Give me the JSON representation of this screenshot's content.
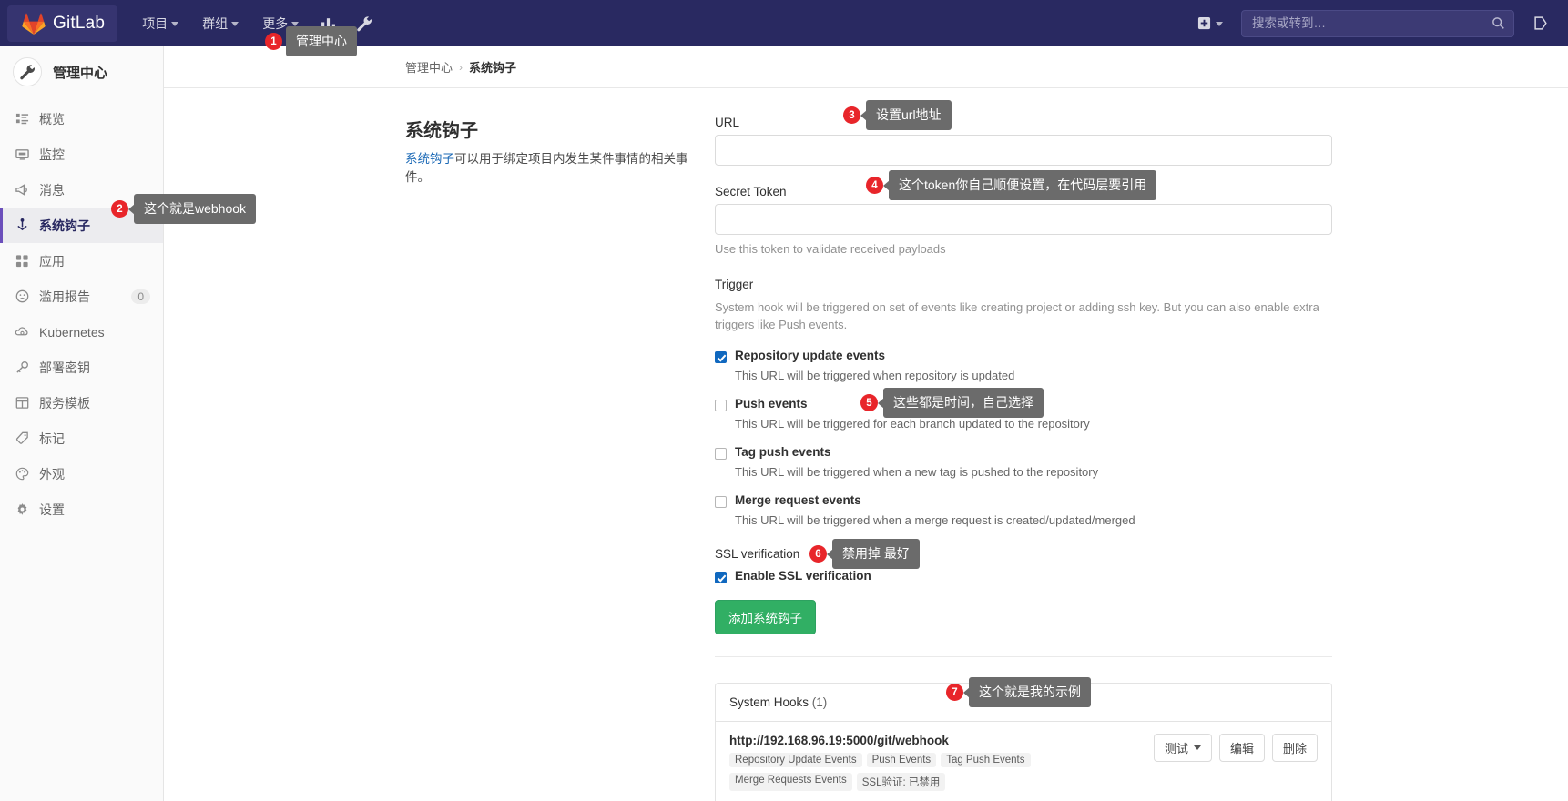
{
  "navbar": {
    "brand": "GitLab",
    "brand_icon": "gitlab-tanuki-logo",
    "items": [
      {
        "label": "项目",
        "icon": "chevron-down-icon"
      },
      {
        "label": "群组",
        "icon": "chevron-down-icon"
      },
      {
        "label": "更多",
        "icon": "chevron-down-icon"
      }
    ],
    "analytics_icon": "chart-bar-icon",
    "admin_icon": "wrench-icon",
    "plus_icon": "plus-square-icon",
    "plus_caret_icon": "chevron-down-icon",
    "search": {
      "placeholder": "搜索或转到…",
      "value": "",
      "icon": "search-icon"
    },
    "issues_icon": "issues-icon"
  },
  "sidebar": {
    "title": "管理中心",
    "avatar_icon": "wrench-icon",
    "items": [
      {
        "label": "概览",
        "icon": "overview-icon",
        "count": "",
        "active": false
      },
      {
        "label": "监控",
        "icon": "monitor-icon",
        "count": "",
        "active": false
      },
      {
        "label": "消息",
        "icon": "megaphone-icon",
        "count": "",
        "active": false
      },
      {
        "label": "系统钩子",
        "icon": "hook-icon",
        "count": "",
        "active": true
      },
      {
        "label": "应用",
        "icon": "applications-icon",
        "count": "",
        "active": false
      },
      {
        "label": "滥用报告",
        "icon": "sad-face-icon",
        "count": "0",
        "active": false
      },
      {
        "label": "Kubernetes",
        "icon": "kubernetes-icon",
        "count": "",
        "active": false
      },
      {
        "label": "部署密钥",
        "icon": "key-icon",
        "count": "",
        "active": false
      },
      {
        "label": "服务模板",
        "icon": "template-icon",
        "count": "",
        "active": false
      },
      {
        "label": "标记",
        "icon": "tag-icon",
        "count": "",
        "active": false
      },
      {
        "label": "外观",
        "icon": "palette-icon",
        "count": "",
        "active": false
      },
      {
        "label": "设置",
        "icon": "gear-icon",
        "count": "",
        "active": false
      }
    ]
  },
  "breadcrumb": {
    "root": "管理中心",
    "separator": "›",
    "current": "系统钩子"
  },
  "page": {
    "heading": "系统钩子",
    "description_link": "系统钩子",
    "description_rest": "可以用于绑定项目内发生某件事情的相关事件。"
  },
  "form": {
    "url_label": "URL",
    "url_value": "",
    "token_label": "Secret Token",
    "token_value": "",
    "token_help": "Use this token to validate received payloads",
    "trigger_label": "Trigger",
    "trigger_help": "System hook will be triggered on set of events like creating project or adding ssh key. But you can also enable extra triggers like Push events.",
    "triggers": [
      {
        "label": "Repository update events",
        "help": "This URL will be triggered when repository is updated",
        "checked": true
      },
      {
        "label": "Push events",
        "help": "This URL will be triggered for each branch updated to the repository",
        "checked": false
      },
      {
        "label": "Tag push events",
        "help": "This URL will be triggered when a new tag is pushed to the repository",
        "checked": false
      },
      {
        "label": "Merge request events",
        "help": "This URL will be triggered when a merge request is created/updated/merged",
        "checked": false
      }
    ],
    "ssl_label": "SSL verification",
    "ssl_checkbox_label": "Enable SSL verification",
    "ssl_checked": true,
    "submit_label": "添加系统钩子"
  },
  "hooks_panel": {
    "header_title": "System Hooks",
    "header_count": "(1)",
    "rows": [
      {
        "url": "http://192.168.96.19:5000/git/webhook",
        "badges": [
          "Repository Update Events",
          "Push Events",
          "Tag Push Events",
          "Merge Requests Events",
          "SSL验证: 已禁用"
        ],
        "actions": [
          {
            "label": "测试",
            "icon": "chevron-down-icon"
          },
          {
            "label": "编辑",
            "icon": ""
          },
          {
            "label": "删除",
            "icon": ""
          }
        ]
      }
    ]
  },
  "annotations": [
    {
      "num": "1",
      "text": "管理中心",
      "arrow": false
    },
    {
      "num": "2",
      "text": "这个就是webhook",
      "arrow": true
    },
    {
      "num": "3",
      "text": "设置url地址",
      "arrow": true
    },
    {
      "num": "4",
      "text": "这个token你自己顺便设置，在代码层要引用",
      "arrow": true
    },
    {
      "num": "5",
      "text": "这些都是时间，自己选择",
      "arrow": true
    },
    {
      "num": "6",
      "text": "禁用掉 最好",
      "arrow": true
    },
    {
      "num": "7",
      "text": "这个就是我的示例",
      "arrow": true
    }
  ],
  "colors": {
    "navbar_bg": "#292961",
    "accent_purple": "#6b4fbb",
    "submit_green": "#31af64",
    "annotation_red": "#e8252a",
    "annotation_bubble": "#6b6b6b",
    "checkbox_blue": "#1068bf",
    "link_blue": "#1b69b6"
  }
}
